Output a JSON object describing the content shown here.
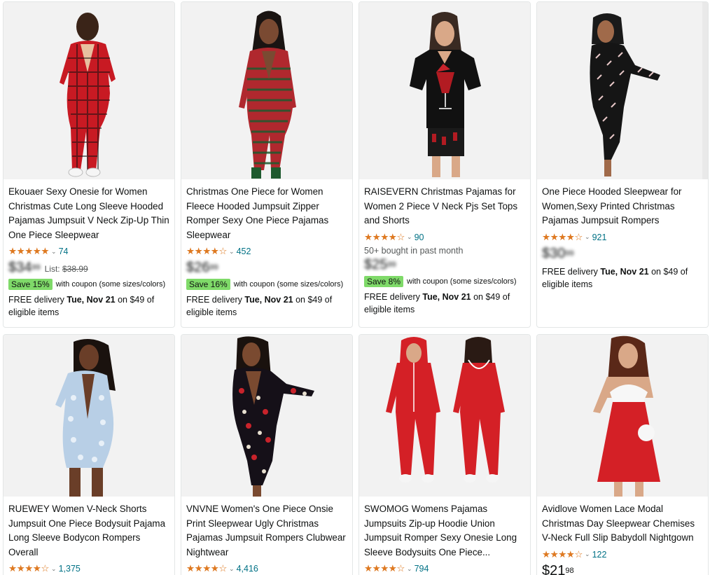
{
  "products": [
    {
      "title": "Ekouaer Sexy Onesie for Women Christmas Cute Long Sleeve Hooded Pajamas Jumpsuit V Neck Zip-Up Thin One Piece Sleepwear",
      "stars": "★★★★★",
      "rating": 4.5,
      "review_count": "74",
      "price": "$34",
      "price_cents": "99",
      "list_label": "List:",
      "list_price": "$38.99",
      "coupon_badge": "Save 15%",
      "coupon_text": "with coupon (some sizes/colors)",
      "delivery_pre": "FREE delivery ",
      "delivery_date": "Tue, Nov 21",
      "delivery_post": " on $49 of eligible items"
    },
    {
      "title": "Christmas One Piece for Women Fleece Hooded Jumpsuit Zipper Romper Sexy One Piece Pajamas Sleepwear",
      "stars": "★★★★☆",
      "rating": 4.0,
      "review_count": "452",
      "price": "$26",
      "price_cents": "99",
      "coupon_badge": "Save 16%",
      "coupon_text": "with coupon (some sizes/colors)",
      "delivery_pre": "FREE delivery ",
      "delivery_date": "Tue, Nov 21",
      "delivery_post": " on $49 of eligible items"
    },
    {
      "title": "RAISEVERN Christmas Pajamas for Women 2 Piece V Neck Pjs Set Tops and Shorts",
      "stars": "★★★★☆",
      "rating": 4.0,
      "review_count": "90",
      "bought": "50+ bought in past month",
      "price": "$25",
      "price_cents": "99",
      "coupon_badge": "Save 8%",
      "coupon_text": "with coupon (some sizes/colors)",
      "delivery_pre": "FREE delivery ",
      "delivery_date": "Tue, Nov 21",
      "delivery_post": " on $49 of eligible items"
    },
    {
      "title": "One Piece Hooded Sleepwear for Women,Sexy Printed Christmas Pajamas Jumpsuit Rompers",
      "stars": "★★★★☆",
      "rating": 4.0,
      "review_count": "921",
      "price": "$30",
      "price_cents": "99",
      "delivery_pre": "FREE delivery ",
      "delivery_date": "Tue, Nov 21",
      "delivery_post": " on $49 of eligible items"
    },
    {
      "title": "RUEWEY Women V-Neck Shorts Jumpsuit One Piece Bodysuit Pajama Long Sleeve Bodycon Rompers Overall",
      "stars": "★★★★☆",
      "rating": 4.0,
      "review_count": "1,375"
    },
    {
      "title": "VNVNE Women's One Piece Onsie Print Sleepwear Ugly Christmas Pajamas Jumpsuit Rompers Clubwear Nightwear",
      "stars": "★★★★☆",
      "rating": 4.0,
      "review_count": "4,416"
    },
    {
      "title": "SWOMOG Womens Pajamas Jumpsuits Zip-up Hoodie Union Jumpsuit Romper Sexy Onesie Long Sleeve Bodysuits One Piece...",
      "stars": "★★★★☆",
      "rating": 4.5,
      "review_count": "794"
    },
    {
      "title": "Avidlove Women Lace Modal Christmas Day Sleepwear Chemises V-Neck Full Slip Babydoll Nightgown",
      "stars": "★★★★☆",
      "rating": 4.0,
      "review_count": "122",
      "price": "$21",
      "price_cents": "98"
    }
  ],
  "colors": {
    "star": "#de7921",
    "link": "#007185",
    "coupon_badge": "#7fda69",
    "card_border": "#e3e6e6"
  }
}
